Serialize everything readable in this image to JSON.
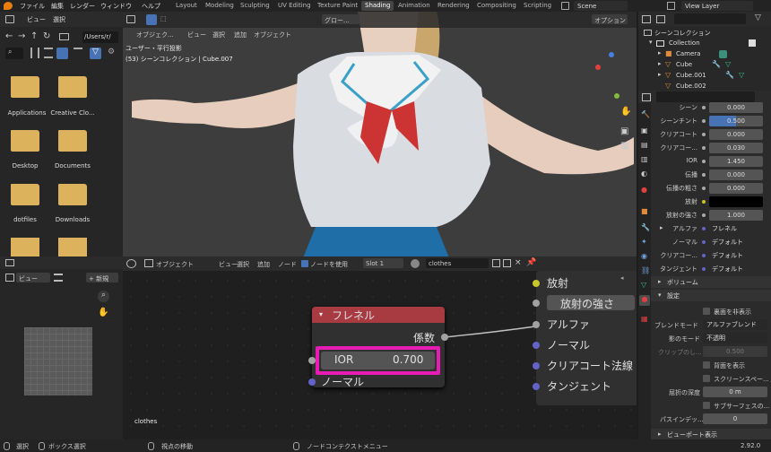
{
  "topbar": {
    "menus": [
      "ファイル",
      "編集",
      "レンダー",
      "ウィンドウ",
      "ヘルプ"
    ],
    "workspaces": [
      "Layout",
      "Modeling",
      "Sculpting",
      "UV Editing",
      "Texture Paint",
      "Shading",
      "Animation",
      "Rendering",
      "Compositing",
      "Scripting"
    ],
    "active_workspace": "Shading",
    "scene": "Scene",
    "view_layer": "View Layer"
  },
  "filebrowser": {
    "menus": [
      "ビュー",
      "選択"
    ],
    "path": "/Users/r/",
    "items": [
      "Applications",
      "Creative Clo...",
      "Desktop",
      "Documents",
      "dotfiles",
      "Downloads",
      "",
      ""
    ]
  },
  "viewport": {
    "mode": "オブジェク...",
    "menus": [
      "ビュー",
      "選択",
      "追加",
      "オブジェクト"
    ],
    "orientation": "グロー...",
    "options": "オプション",
    "view_name": "ユーザー・平行投影",
    "collection_info": "(53) シーンコレクション | Cube.007"
  },
  "outliner": {
    "title": "シーンコレクション",
    "items": [
      "Collection",
      "Camera",
      "Cube",
      "Cube.001",
      "Cube.002"
    ]
  },
  "properties": {
    "rows": [
      {
        "label": "シーン",
        "value": "0.000"
      },
      {
        "label": "シーンチント",
        "value": "0.500"
      },
      {
        "label": "クリアコート",
        "value": "0.000"
      },
      {
        "label": "クリアコー...",
        "value": "0.030"
      },
      {
        "label": "IOR",
        "value": "1.450"
      },
      {
        "label": "伝播",
        "value": "0.000"
      },
      {
        "label": "伝播の粗さ",
        "value": "0.000"
      },
      {
        "label": "放射",
        "value": ""
      },
      {
        "label": "放射の強さ",
        "value": "1.000"
      },
      {
        "label": "アルファ",
        "value": "フレネル"
      },
      {
        "label": "ノーマル",
        "value": "デフォルト"
      },
      {
        "label": "クリアコー...",
        "value": "デフォルト"
      },
      {
        "label": "タンジェント",
        "value": "デフォルト"
      }
    ],
    "volume": "ボリューム",
    "settings": "設定",
    "backface": "裏面を非表示",
    "blend_mode_label": "ブレンドモード",
    "blend_mode": "アルファブレンド",
    "shadow_mode_label": "影のモード",
    "shadow_mode": "不透明",
    "clip_label": "クリップのし...",
    "clip_value": "0.500",
    "show_backface": "背面を表示",
    "screen_space": "スクリーンスペー...",
    "refraction_depth_label": "屈折の深度",
    "refraction_depth": "0 m",
    "subsurface": "サブサーフェスの...",
    "pass_index_label": "パスインデッ...",
    "pass_index": "0",
    "viewport_display": "ビューポート表示",
    "version": "2.92.0"
  },
  "nodeeditor": {
    "mode": "オブジェクト",
    "menus": [
      "ビュー",
      "選択",
      "追加",
      "ノード"
    ],
    "use_nodes": "ノードを使用",
    "slot": "Slot 1",
    "material": "clothes",
    "node_title": "フレネル",
    "node_output": "係数",
    "ior_label": "IOR",
    "ior_value": "0.700",
    "node_input": "ノーマル",
    "bsdf_inputs": [
      "放射",
      "放射の強さ",
      "アルファ",
      "ノーマル",
      "クリアコート法線",
      "タンジェント"
    ],
    "material_label": "clothes"
  },
  "leftbottom": {
    "view": "ビュー",
    "new": "新規"
  },
  "statusbar": {
    "items": [
      "選択",
      "ボックス選択",
      "視点の移動",
      "ノードコンテクストメニュー"
    ]
  }
}
